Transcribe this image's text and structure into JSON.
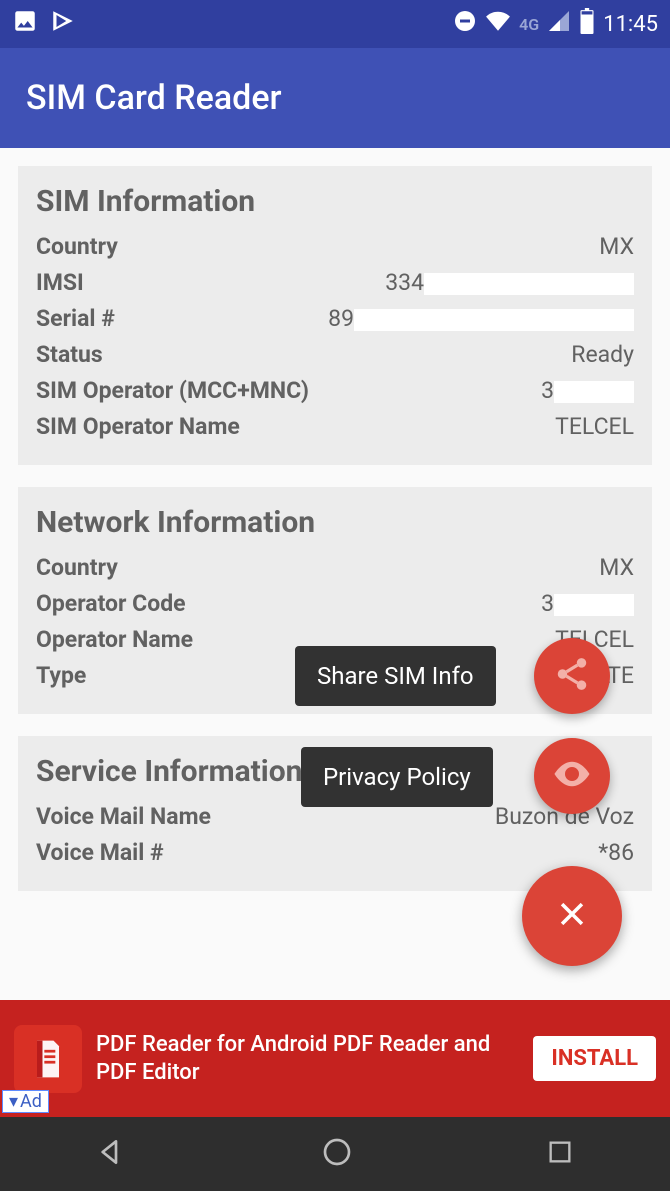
{
  "status": {
    "time": "11:45",
    "network_label": "4G"
  },
  "app": {
    "title": "SIM Card Reader"
  },
  "sim": {
    "heading": "SIM Information",
    "country_label": "Country",
    "country": "MX",
    "imsi_label": "IMSI",
    "imsi": "334",
    "serial_label": "Serial #",
    "serial": "89",
    "status_label": "Status",
    "status": "Ready",
    "mcc_label": "SIM Operator (MCC+MNC)",
    "mcc": "3",
    "opname_label": "SIM Operator Name",
    "opname": "TELCEL"
  },
  "net": {
    "heading": "Network Information",
    "country_label": "Country",
    "country": "MX",
    "opcode_label": "Operator Code",
    "opcode": "3",
    "opname_label": "Operator Name",
    "opname": "TELCEL",
    "type_label": "Type",
    "type": "LTE"
  },
  "service": {
    "heading": "Service Information",
    "vm_name_label": "Voice Mail Name",
    "vm_name": "Buzon de Voz",
    "vm_num_label": "Voice Mail #",
    "vm_num": "*86"
  },
  "actions": {
    "share_label": "Share SIM Info",
    "privacy_label": "Privacy Policy"
  },
  "ad": {
    "text": "PDF Reader for Android PDF Reader and PDF Editor",
    "cta": "INSTALL",
    "tag": "Ad"
  }
}
